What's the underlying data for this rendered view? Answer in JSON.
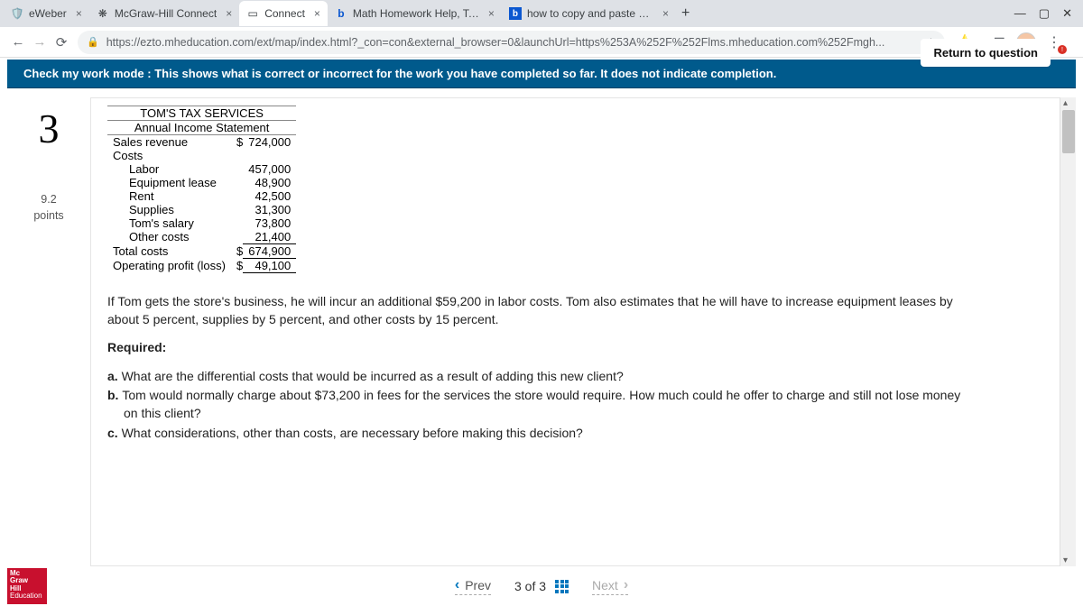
{
  "browser": {
    "tabs": [
      {
        "title": "eWeber",
        "icon": "shield-purple"
      },
      {
        "title": "McGraw-Hill Connect",
        "icon": "flower"
      },
      {
        "title": "Connect",
        "icon": "doc",
        "active": true
      },
      {
        "title": "Math Homework Help, Textbook",
        "icon": "b"
      },
      {
        "title": "how to copy and paste on keybo",
        "icon": "b-box"
      }
    ],
    "url": "https://ezto.mheducation.com/ext/map/index.html?_con=con&external_browser=0&launchUrl=https%253A%252F%252Flms.mheducation.com%252Fmgh..."
  },
  "banner": "Check my work mode : This shows what is correct or incorrect for the work you have completed so far. It does not indicate completion.",
  "return_btn": "Return to question",
  "question": {
    "number": "3",
    "points_value": "9.2",
    "points_label": "points"
  },
  "statement": {
    "title1": "TOM'S TAX SERVICES",
    "title2": "Annual Income Statement",
    "rows": {
      "sales_label": "Sales revenue",
      "sales_val": "724,000",
      "costs_label": "Costs",
      "labor_label": "Labor",
      "labor_val": "457,000",
      "equip_label": "Equipment lease",
      "equip_val": "48,900",
      "rent_label": "Rent",
      "rent_val": "42,500",
      "supplies_label": "Supplies",
      "supplies_val": "31,300",
      "salary_label": "Tom's salary",
      "salary_val": "73,800",
      "other_label": "Other costs",
      "other_val": "21,400",
      "total_label": "Total costs",
      "total_val": "674,900",
      "profit_label": "Operating profit (loss)",
      "profit_val": "49,100"
    }
  },
  "prose": {
    "intro": "If Tom gets the store's business, he will incur an additional $59,200 in labor costs. Tom also estimates that he will have to increase equipment leases by about 5 percent, supplies by 5 percent, and other costs by 15 percent.",
    "required": "Required:",
    "a_pre": "a. ",
    "a": "What are the differential costs that would be incurred as a result of adding this new client?",
    "b_pre": "b. ",
    "b": "Tom would normally charge about $73,200 in fees for the services the store would require. How much could he offer to charge and still not lose money on this client?",
    "c_pre": "c. ",
    "c": "What considerations, other than costs, are necessary before making this decision?"
  },
  "footer": {
    "logo_lines": "Mc\nGraw\nHill\nEducation",
    "prev": "Prev",
    "pager": "3 of 3",
    "next": "Next"
  }
}
